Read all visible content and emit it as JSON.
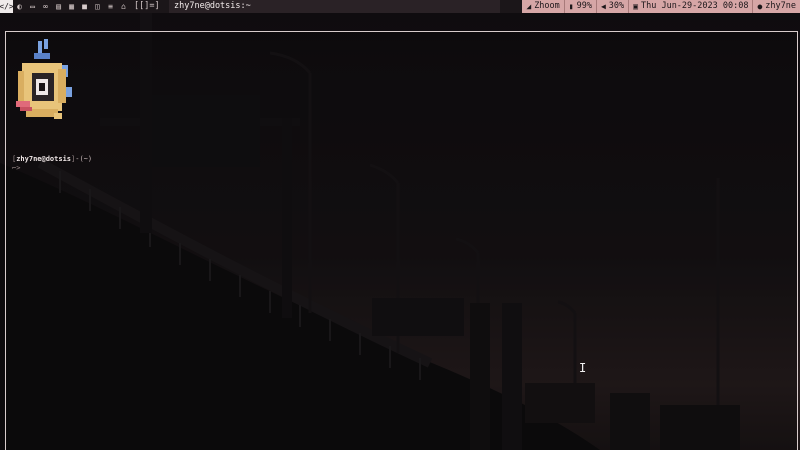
{
  "topbar": {
    "workspaces": [
      {
        "icon": "code-icon",
        "glyph": "</>"
      },
      {
        "icon": "palette-icon",
        "glyph": "◐"
      },
      {
        "icon": "terminal-icon",
        "glyph": "▭"
      },
      {
        "icon": "infinity-icon",
        "glyph": "∞"
      },
      {
        "icon": "chat-icon",
        "glyph": "▤"
      },
      {
        "icon": "film-icon",
        "glyph": "▦"
      },
      {
        "icon": "video-icon",
        "glyph": "■"
      },
      {
        "icon": "gamepad-icon",
        "glyph": "◫"
      },
      {
        "icon": "bars-icon",
        "glyph": "≡"
      },
      {
        "icon": "home-icon",
        "glyph": "⌂"
      }
    ],
    "active_workspace": 0,
    "layout": "[[]=]",
    "window_title": "zhy7ne@dotsis:~",
    "modules": {
      "wifi": {
        "icon": "wifi-icon",
        "glyph": "◢",
        "text": "Zhoom"
      },
      "battery": {
        "icon": "battery-icon",
        "glyph": "▮",
        "text": "99%"
      },
      "volume": {
        "icon": "volume-icon",
        "glyph": "◀",
        "text": "30%"
      },
      "clock": {
        "icon": "calendar-icon",
        "glyph": "▣",
        "text": "Thu Jun-29-2023 00:08"
      },
      "user": {
        "icon": "user-icon",
        "glyph": "●",
        "text": "zhy7ne"
      }
    },
    "colors": {
      "bar_bg": "#1b1619",
      "accent": "#d6a6a6",
      "title_bg": "#2a2226"
    }
  },
  "terminal": {
    "prompt": {
      "open": "[",
      "user_host": "zhy7ne@dotsis",
      "close": "]",
      "path": "-(~)",
      "line2": "⌐>"
    },
    "cursor_glyph": "I"
  }
}
